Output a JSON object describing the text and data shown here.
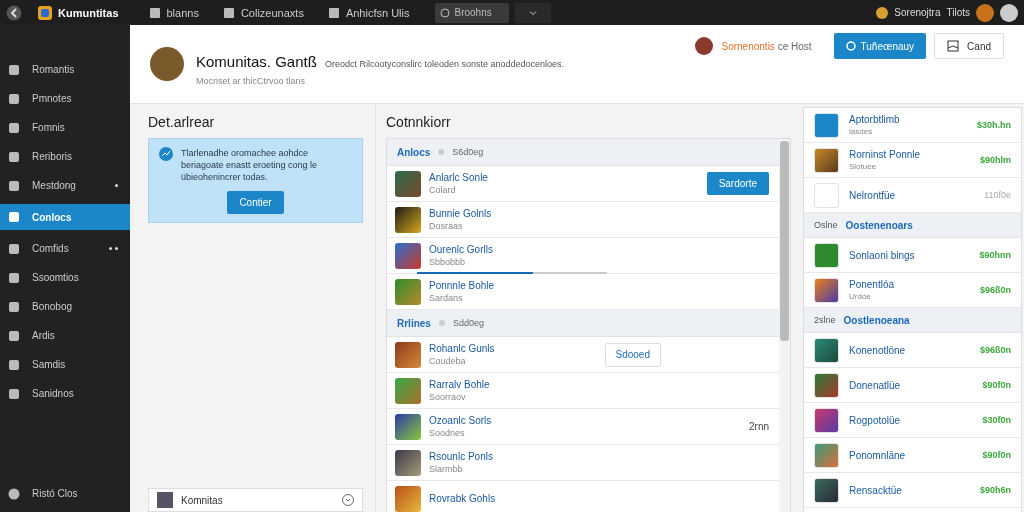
{
  "topbar": {
    "app_name": "Kumuntitas",
    "nav": [
      "blanns",
      "Colizeunaxts",
      "Anhicfsn Ulis"
    ],
    "search": {
      "placeholder": "Broohns"
    },
    "user": "Sorenojtra",
    "link": "Tilots"
  },
  "sidebar": {
    "items": [
      {
        "label": "Romantis",
        "selected": false,
        "kind": "plain"
      },
      {
        "label": "Pmnotes",
        "selected": false,
        "kind": "plain"
      },
      {
        "label": "Fomnis",
        "selected": false,
        "kind": "plain"
      },
      {
        "label": "Reriboris",
        "selected": false,
        "kind": "plain"
      },
      {
        "label": "Mestdong",
        "selected": false,
        "kind": "dot"
      },
      {
        "label": "Conlocs",
        "selected": true,
        "kind": "plain"
      },
      {
        "label": "Comfids",
        "selected": false,
        "kind": "dots"
      },
      {
        "label": "Ssoomtios",
        "selected": false,
        "kind": "plain"
      },
      {
        "label": "Bonobog",
        "selected": false,
        "kind": "plain"
      },
      {
        "label": "Ardis",
        "selected": false,
        "kind": "plain"
      },
      {
        "label": "Samdis",
        "selected": false,
        "kind": "plain"
      },
      {
        "label": "Sanidnos",
        "selected": false,
        "kind": "plain"
      }
    ],
    "footer": "Ristó Clos"
  },
  "header": {
    "title": "Komunitas. Gantß",
    "description": "Oreodct Rilcootyconslirc toleoden sonste anoddedocenloes.",
    "subtitle": "Mocnset ar thicCtrvoo tlans",
    "host_name": "Sornenontis",
    "host_suffix": "ce Host",
    "primary_button": "Tuñeœnauy",
    "secondary_button": "Cand"
  },
  "details": {
    "heading": "Det.arlrear",
    "info_text": "Tlarlenadhe oromachee aohdce beriagoate enastt eroeting cong le übieohenincrer todas.",
    "info_button": "Contier",
    "member": "Komnitas"
  },
  "content": {
    "heading": "Cotnnkiorr",
    "groups": [
      {
        "title": "Anlocs",
        "subtitle": "S6d0eg",
        "rows": [
          {
            "title": "Anlarlc Sonle",
            "subtitle": "Colard",
            "kind": "primary",
            "action": "Sardorte"
          },
          {
            "title": "Bunnie Golnls",
            "subtitle": "Dosraas",
            "kind": "plain"
          },
          {
            "title": "Ourenlc Gorlls",
            "subtitle": "Sbbobbb",
            "kind": "progress",
            "level": 0.61
          },
          {
            "title": "Ponnnle Bohle",
            "subtitle": "Sardans",
            "kind": "plain"
          }
        ]
      },
      {
        "title": "Rrlines",
        "subtitle": "Sdd0eg",
        "rows": [
          {
            "title": "Rohanlc Gunls",
            "subtitle": "Coudeba",
            "kind": "outline",
            "action": "Sdooed"
          },
          {
            "title": "Rarralv Bohle",
            "subtitle": "Soorraov",
            "kind": "plain"
          },
          {
            "title": "Ozoanlc Sorls",
            "subtitle": "Soodnes",
            "kind": "note",
            "action": "2rnn"
          },
          {
            "title": "Rsounlc Ponls",
            "subtitle": "Slarmbb",
            "kind": "plain"
          },
          {
            "title": "Rovrabk Gohls",
            "kind": "plain"
          }
        ]
      }
    ]
  },
  "store": {
    "groups": [
      {
        "rows": [
          {
            "title": "Aptorbtlimb",
            "subtitle": "lasdes",
            "price": "$30h.hn",
            "available": true
          },
          {
            "title": "Rorninst Ponnle",
            "subtitle": "Slotuee",
            "price": "$90hlm",
            "available": true
          },
          {
            "title": "Nelrontfüe",
            "price": "110f0e",
            "available": false
          }
        ]
      },
      {
        "label": "Oslne",
        "title": "Oostenenoars",
        "rows": [
          {
            "title": "Sonlaoni bings",
            "price": "$90hnn",
            "available": true
          },
          {
            "title": "Ponentlóa",
            "subtitle": "Urdóe",
            "price": "$96ß0n",
            "available": true
          }
        ]
      },
      {
        "label": "2slne",
        "title": "Oostlenoeana",
        "rows": [
          {
            "title": "Konenotlöne",
            "price": "$96ß0n",
            "available": true
          },
          {
            "title": "Donenatlüe",
            "price": "$90f0n",
            "available": true
          },
          {
            "title": "Rogpotolüe",
            "price": "$30f0n",
            "available": true
          },
          {
            "title": "Ponomnläne",
            "price": "$90f0n",
            "available": true
          },
          {
            "title": "Rensacktüe",
            "price": "$90h6n",
            "available": true
          }
        ]
      }
    ]
  }
}
